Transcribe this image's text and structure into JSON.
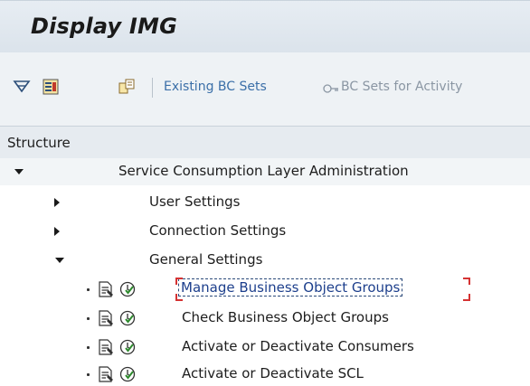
{
  "header": {
    "title": "Display IMG"
  },
  "toolbar": {
    "existing_bc_sets": "Existing BC Sets",
    "bc_sets_for_activity": "BC Sets for Activity",
    "icons": [
      "filter-icon",
      "bookmark-icon",
      "where-used-icon",
      "bc-set-key-icon"
    ]
  },
  "structure": {
    "header": "Structure",
    "root": {
      "label": "Service Consumption Layer Administration",
      "expanded": true
    },
    "nodes": [
      {
        "label": "User Settings",
        "expanded": false
      },
      {
        "label": "Connection Settings",
        "expanded": false
      },
      {
        "label": "General Settings",
        "expanded": true
      }
    ],
    "activities": [
      {
        "label": "Manage Business Object Groups",
        "focused": true
      },
      {
        "label": "Check Business Object Groups",
        "focused": false
      },
      {
        "label": "Activate or Deactivate Consumers",
        "focused": false
      },
      {
        "label": "Activate or Deactivate SCL",
        "focused": false
      }
    ]
  },
  "colors": {
    "link": "#3b6fa8",
    "focus": "#d53333",
    "header_bg": "#e6ebf0"
  }
}
